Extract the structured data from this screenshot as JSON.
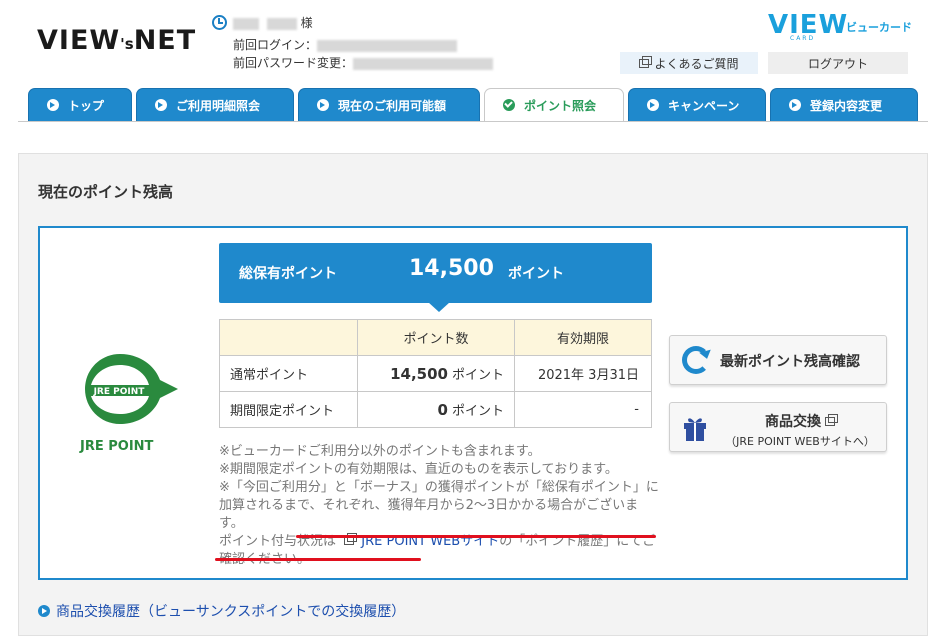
{
  "header": {
    "logo_main": "VIEW",
    "logo_s": "'s",
    "logo_net": "NET",
    "user_suffix": "様",
    "last_login_label": "前回ログイン：",
    "last_pw_change_label": "前回パスワード変更：",
    "card_logo": "VIEW",
    "card_logo_label": "ビューカード",
    "card_logo_sub": "CARD",
    "faq_label": "よくあるご質問",
    "logout_label": "ログアウト"
  },
  "tabs": [
    {
      "label": "トップ",
      "active": false
    },
    {
      "label": "ご利用明細照会",
      "active": false
    },
    {
      "label": "現在のご利用可能額",
      "active": false
    },
    {
      "label": "ポイント照会",
      "active": true
    },
    {
      "label": "キャンペーン",
      "active": false
    },
    {
      "label": "登録内容変更",
      "active": false
    }
  ],
  "main": {
    "section_title": "現在のポイント残高",
    "brand_logo_text": "JRE POINT",
    "brand_label": "JRE POINT",
    "total": {
      "label": "総保有ポイント",
      "value": "14,500",
      "unit": "ポイント"
    },
    "table": {
      "headers": [
        "",
        "ポイント数",
        "有効期限"
      ],
      "rows": [
        {
          "label": "通常ポイント",
          "value": "14,500",
          "unit": "ポイント",
          "expiry": "2021年 3月31日"
        },
        {
          "label": "期間限定ポイント",
          "value": "0",
          "unit": "ポイント",
          "expiry": "-"
        }
      ]
    },
    "notes": {
      "line1": "※ビューカードご利用分以外のポイントも含まれます。",
      "line2": "※期間限定ポイントの有効期限は、直近のものを表示しております。",
      "line3": "※「今回ご利用分」と「ボーナス」の獲得ポイントが「総保有ポイント」に加算されるまで、それぞれ、獲得年月から2～3日かかる場合がございます。",
      "line4_prefix": "ポイント付与状況は",
      "line4_link": "JRE POINT WEBサイト",
      "line4_suffix": "の「ポイント履歴」にてご確認ください。"
    },
    "buttons": {
      "refresh_label": "最新ポイント残高確認",
      "exchange_label": "商品交換",
      "exchange_sub": "（JRE POINT WEBサイトへ）"
    },
    "history_link": "商品交換履歴（ビューサンクスポイントでの交換履歴）"
  },
  "colors": {
    "tab_blue": "#1f89cc",
    "active_green": "#2a9c5a",
    "brand_cyan": "#1aa0dc",
    "jre_green": "#2a8a3e",
    "annotation_red": "#e0101e"
  }
}
